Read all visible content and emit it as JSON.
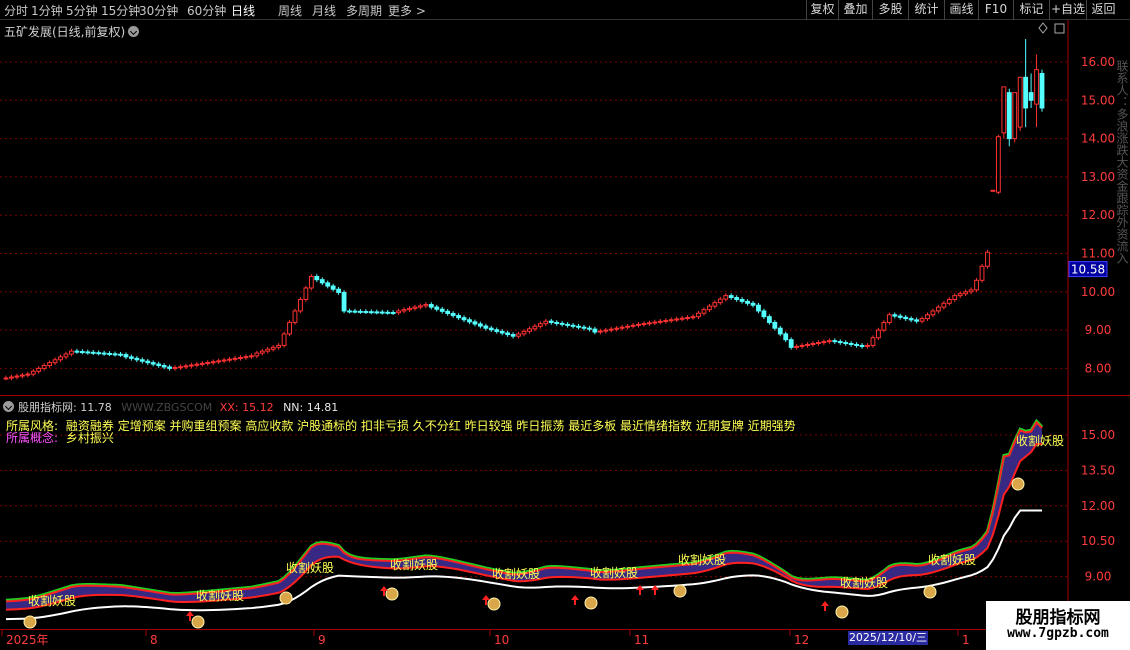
{
  "toolbar": {
    "periods": [
      "分时",
      "1分钟",
      "5分钟",
      "15分钟",
      "30分钟",
      "60分钟",
      "日线",
      "周线",
      "月线",
      "多周期",
      "更多 >"
    ],
    "active_period": "日线",
    "buttons": [
      "复权",
      "叠加",
      "多股",
      "统计",
      "画线",
      "F10",
      "标记",
      "+自选",
      "返回"
    ]
  },
  "main": {
    "title": "五矿发展(日线,前复权)",
    "price_tag": "10.58",
    "y_ticks": [
      "16.00",
      "15.00",
      "14.00",
      "13.00",
      "12.00",
      "11.00",
      "10.00",
      "9.00",
      "8.00"
    ]
  },
  "sub": {
    "name": "股朋指标网",
    "value": ": 11.78",
    "site": "WWW.ZBGSCOM",
    "xx_label": "XX: 15.12",
    "nn_label": "NN: 14.81",
    "style_label": "所属风格:",
    "style_text": "融资融券 定增预案 并购重组预案 高应收款 沪股通标的 扣非亏损 久不分红 昨日较强 昨日振荡 最近多板 最近情绪指数 近期复牌 近期强势",
    "concept_label": "所属概念:",
    "concept_text": "乡村振兴",
    "y_ticks": [
      "15.00",
      "13.50",
      "12.00",
      "10.50",
      "9.00"
    ],
    "signal_text": "收割妖股"
  },
  "x_axis": {
    "labels": [
      "2025年",
      "8",
      "9",
      "10",
      "11",
      "12",
      "1"
    ],
    "cursor_date": "2025/12/10/三"
  },
  "watermark": {
    "line1": "股朋指标网",
    "line2": "www.7gpzb.com"
  },
  "side_strip": "联系人：多浪涨跌大资金跟踪外资流入",
  "colors": {
    "up": "#ff3232",
    "down": "#54ffff",
    "grid": "#7a0000",
    "label": "#ffff54",
    "white": "#ffffff"
  }
}
